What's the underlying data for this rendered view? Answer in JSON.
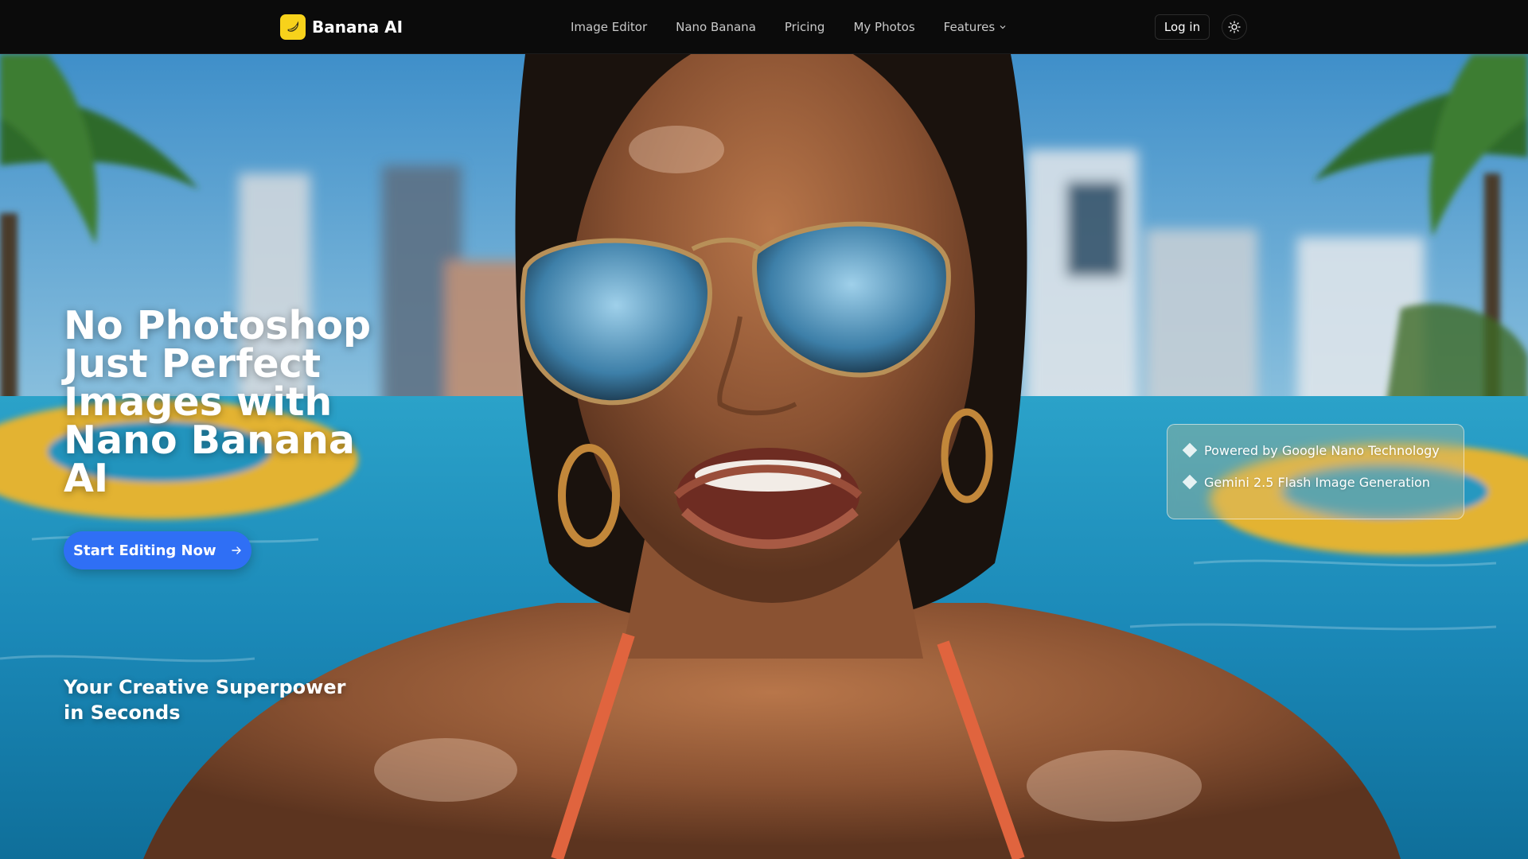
{
  "nav": {
    "brand_name": "Banana AI",
    "links": [
      {
        "label": "Image Editor"
      },
      {
        "label": "Nano Banana"
      },
      {
        "label": "Pricing"
      },
      {
        "label": "My Photos"
      },
      {
        "label": "Features"
      }
    ],
    "login_label": "Log in"
  },
  "hero": {
    "headline": "No Photoshop Just Perfect Images with Nano Banana AI",
    "cta_label": "Start Editing Now",
    "tagline": "Your Creative Superpower in Seconds",
    "features": [
      {
        "text": "Powered by Google Nano Technology"
      },
      {
        "text": "Gemini 2.5 Flash Image Generation"
      }
    ]
  },
  "colors": {
    "accent": "#2f6ff5",
    "brand_yellow": "#f7d21b",
    "nav_bg": "#0b0b0b"
  },
  "icons": {
    "brand": "banana-icon",
    "features_dropdown": "chevron-down-icon",
    "cta": "arrow-right-icon",
    "theme": "sun-icon",
    "bullet": "diamond-icon"
  }
}
